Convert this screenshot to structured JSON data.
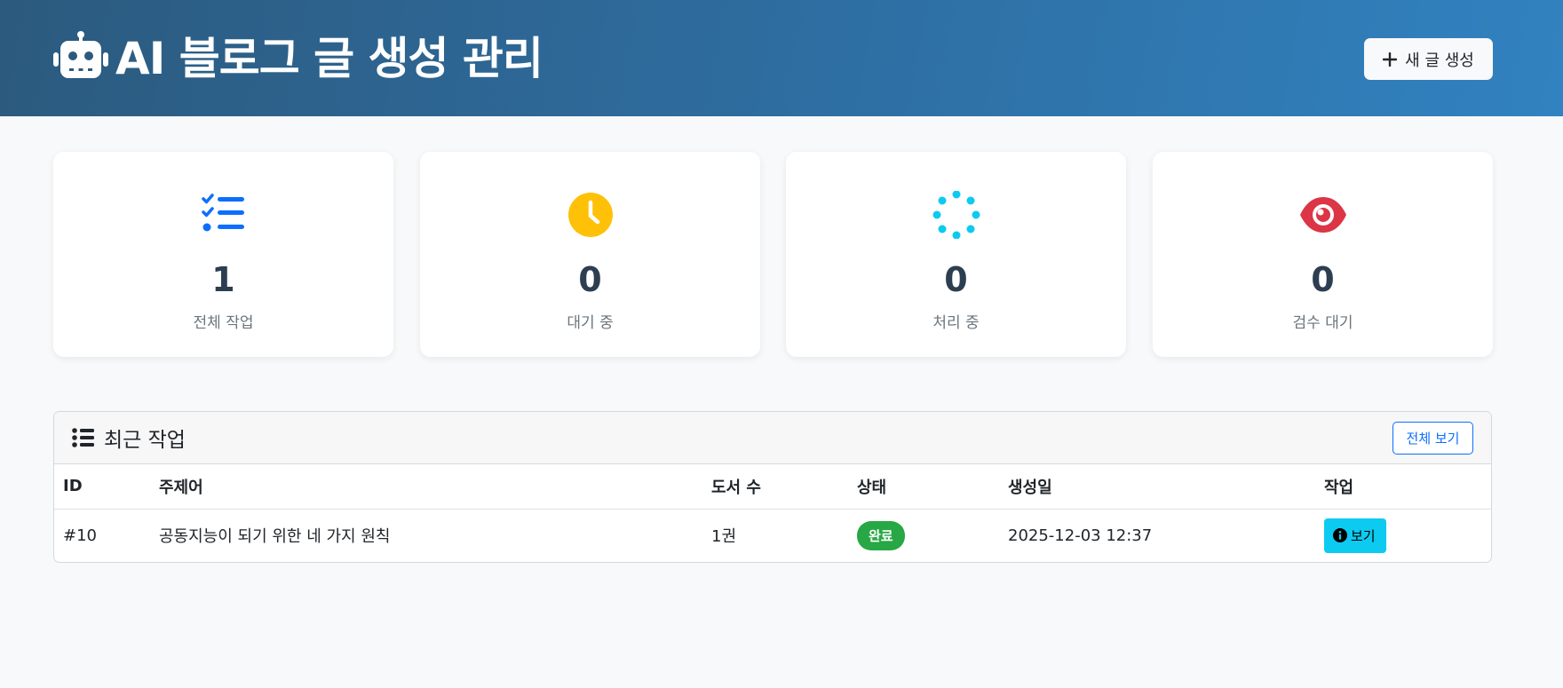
{
  "header": {
    "title": "AI 블로그 글 생성 관리",
    "new_button_label": "새 글 생성",
    "brand_icon": "robot-icon"
  },
  "stats": [
    {
      "value": "1",
      "label": "전체 작업",
      "icon": "list-check-icon",
      "color": "#0d6efd"
    },
    {
      "value": "0",
      "label": "대기 중",
      "icon": "clock-icon",
      "color": "#ffc107"
    },
    {
      "value": "0",
      "label": "처리 중",
      "icon": "spinner-icon",
      "color": "#0dcaf0"
    },
    {
      "value": "0",
      "label": "검수 대기",
      "icon": "eye-icon",
      "color": "#dc3545"
    }
  ],
  "recent": {
    "title": "최근 작업",
    "view_all_label": "전체 보기",
    "columns": [
      "ID",
      "주제어",
      "도서 수",
      "상태",
      "생성일",
      "작업"
    ],
    "rows": [
      {
        "id": "#10",
        "topic": "공동지능이 되기 위한 네 가지 원칙",
        "books": "1권",
        "status": "완료",
        "created": "2025-12-03 12:37",
        "action": "보기"
      }
    ]
  },
  "colors": {
    "header_start": "#2c5a7e",
    "header_end": "#3182c0",
    "success": "#28a745",
    "info": "#0dcaf0",
    "primary": "#0d6efd"
  }
}
